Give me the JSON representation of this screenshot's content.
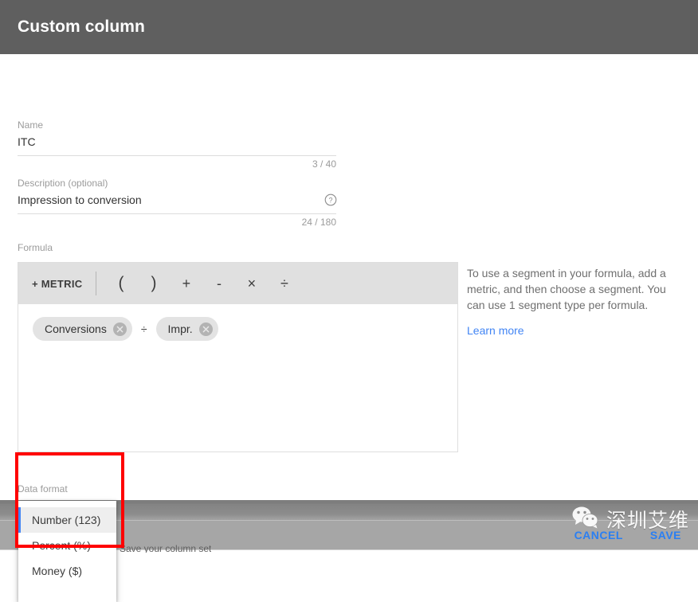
{
  "dialog": {
    "title": "Custom column",
    "name_field": {
      "label": "Name",
      "value": "ITC",
      "counter": "3 / 40"
    },
    "description_field": {
      "label": "Description (optional)",
      "value": "Impression to conversion",
      "counter": "24 / 180",
      "help_icon": "help-circle-icon"
    },
    "formula": {
      "label": "Formula",
      "add_metric_label": "+ METRIC",
      "operators": [
        "(",
        ")",
        "+",
        "-",
        "×",
        "÷"
      ],
      "expression": [
        {
          "type": "metric",
          "label": "Conversions"
        },
        {
          "type": "operator",
          "label": "÷"
        },
        {
          "type": "metric",
          "label": "Impr."
        }
      ]
    },
    "side_help": {
      "text": "To use a segment in your formula, add a metric, and then choose a segment. You can use 1 segment type per formula.",
      "link_label": "Learn more"
    },
    "data_format": {
      "label": "Data format",
      "options": [
        {
          "label": "Number (123)",
          "selected": true
        },
        {
          "label": "Percent (%)",
          "selected": false
        },
        {
          "label": "Money ($)",
          "selected": false
        }
      ]
    },
    "actions": {
      "cancel_label": "CANCEL",
      "save_label": "SAVE"
    }
  },
  "annotation": {
    "color": "#ff0000"
  },
  "watermark": {
    "text": "深圳艾维",
    "icon": "wechat-icon"
  },
  "background": {
    "row_text": "Save your column set"
  },
  "colors": {
    "header_bg": "#5f5f5f",
    "accent_link": "#4285f4",
    "action_blue": "#2a7ff3",
    "toolbar_bg": "#e0e0e0",
    "chip_bg": "#e3e3e3",
    "selected_row_bg": "#eeeeee"
  }
}
